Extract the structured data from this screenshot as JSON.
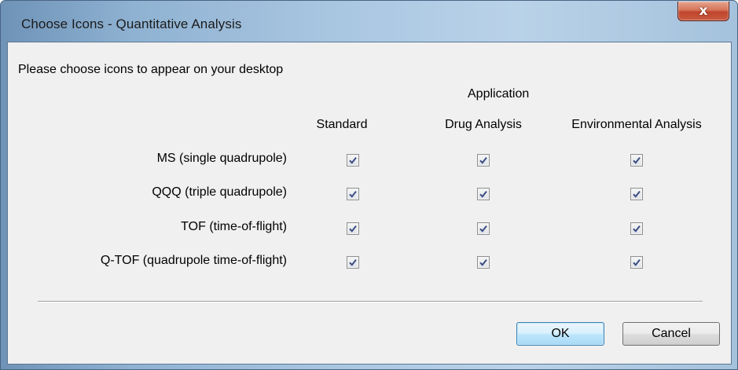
{
  "window": {
    "title": "Choose Icons - Quantitative Analysis",
    "close_symbol": "x"
  },
  "dialog": {
    "instruction": "Please choose icons to appear on your desktop",
    "group_header": "Application",
    "columns": [
      "Standard",
      "Drug Analysis",
      "Environmental Analysis"
    ],
    "rows": [
      {
        "label": "MS (single quadrupole)",
        "checked": [
          true,
          true,
          true
        ]
      },
      {
        "label": "QQQ (triple quadrupole)",
        "checked": [
          true,
          true,
          true
        ]
      },
      {
        "label": "TOF (time-of-flight)",
        "checked": [
          true,
          true,
          true
        ]
      },
      {
        "label": "Q-TOF (quadrupole time-of-flight)",
        "checked": [
          true,
          true,
          true
        ]
      }
    ]
  },
  "buttons": {
    "ok": "OK",
    "cancel": "Cancel"
  }
}
